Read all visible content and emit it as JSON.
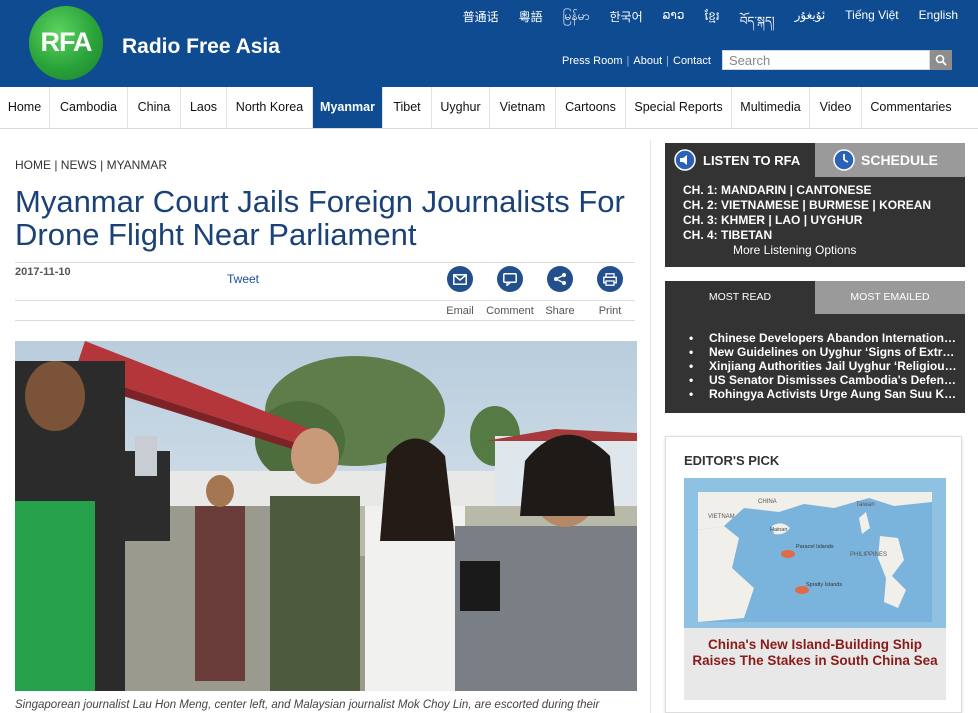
{
  "header": {
    "logo_text": "RFA",
    "brand": "Radio Free Asia",
    "languages": [
      "普通话",
      "粵語",
      "မြန်မာ",
      "한국어",
      "ລາວ",
      "ខ្មែរ",
      "བོད་སྐད།",
      "ئۇيغۇر",
      "Tiếng Việt",
      "English"
    ],
    "top_links": [
      "Press Room",
      "About",
      "Contact"
    ],
    "search_placeholder": "Search",
    "colors": {
      "header_bg": "#0f4b91",
      "logo_green": "#2aa33a"
    }
  },
  "nav": {
    "items": [
      "Home",
      "Cambodia",
      "China",
      "Laos",
      "North Korea",
      "Myanmar",
      "Tibet",
      "Uyghur",
      "Vietnam",
      "Cartoons",
      "Special Reports",
      "Multimedia",
      "Video",
      "Commentaries"
    ],
    "active": "Myanmar"
  },
  "article": {
    "breadcrumb": "HOME | NEWS | MYANMAR",
    "headline": "Myanmar Court Jails Foreign Journalists For Drone Flight Near Parliament",
    "date": "2017-11-10",
    "tweet_label": "Tweet",
    "tools": [
      {
        "label": "Email",
        "icon": "email-icon"
      },
      {
        "label": "Comment",
        "icon": "comment-icon"
      },
      {
        "label": "Share",
        "icon": "share-icon"
      },
      {
        "label": "Print",
        "icon": "print-icon"
      }
    ],
    "caption": "Singaporean journalist Lau Hon Meng, center left, and Malaysian journalist Mok Choy Lin, are escorted during their"
  },
  "listen": {
    "tab_label": "LISTEN TO RFA",
    "schedule_label": "SCHEDULE",
    "channels": [
      "CH. 1: MANDARIN | CANTONESE",
      "CH. 2: VIETNAMESE | BURMESE | KOREAN",
      "CH. 3: KHMER | LAO | UYGHUR",
      "CH. 4: TIBETAN"
    ],
    "more": "More Listening Options"
  },
  "most": {
    "tab_read": "MOST READ",
    "tab_emailed": "MOST EMAILED",
    "items": [
      "Chinese Developers Abandon International Airport Project",
      "New Guidelines on Uyghur ‘Signs of Extremism’",
      "Xinjiang Authorities Jail Uyghur ‘Religious Extremists’",
      "US Senator Dismisses Cambodia's Defense Claims",
      "Rohingya Activists Urge Aung San Suu Kyi to Act"
    ]
  },
  "editors_pick": {
    "title": "EDITOR'S PICK",
    "map_labels": [
      "CHINA",
      "Taiwan",
      "VIETNAM",
      "Hainan",
      "Paracel Islands",
      "PHILIPPINES",
      "Spratly Islands"
    ],
    "story": "China's New Island-Building Ship Raises The Stakes in South China Sea"
  }
}
